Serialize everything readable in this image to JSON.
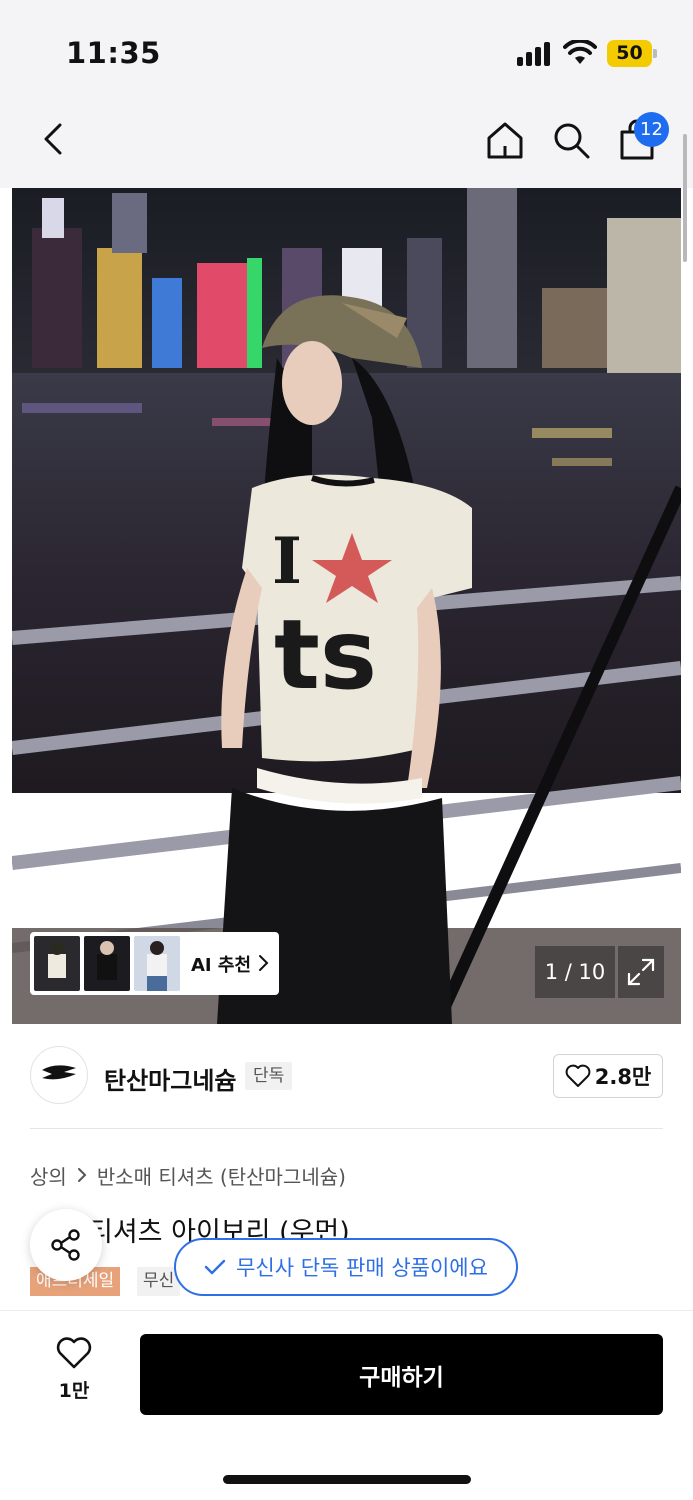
{
  "status": {
    "time": "11:35",
    "battery": "50"
  },
  "nav": {
    "cart_count": "12"
  },
  "gallery": {
    "ai_label": "AI 추천",
    "page_current": "1",
    "page_total": "10",
    "page_counter": "1 / 10"
  },
  "brand": {
    "name": "탄산마그네슘",
    "badge": "단독",
    "likes": "2.8만"
  },
  "product": {
    "breadcrumb": [
      "상의",
      "반소매 티셔츠 (탄산마그네슘)"
    ],
    "title": "티셔츠 아이보리 (우먼)",
    "tags": [
      "애프터세일",
      "무신"
    ]
  },
  "toast": {
    "text": "무신사 단독 판매 상품이에요"
  },
  "bottom": {
    "wish_count": "1만",
    "buy_label": "구매하기"
  },
  "colors": {
    "accent": "#2f6fe4",
    "badge_blue": "#1e6cf0",
    "sale_tag": "#e8a27a",
    "battery": "#f4cb00",
    "buy_button": "#000000"
  }
}
